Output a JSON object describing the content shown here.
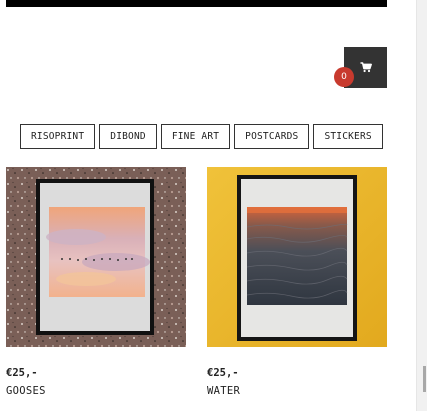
{
  "cart": {
    "count": "0",
    "icon": "cart-icon"
  },
  "filters": [
    {
      "label": "RISOPRINT"
    },
    {
      "label": "DIBOND"
    },
    {
      "label": "FINE ART"
    },
    {
      "label": "POSTCARDS"
    },
    {
      "label": "STICKERS"
    }
  ],
  "products": [
    {
      "price": "€25,-",
      "title": "GOOSES"
    },
    {
      "price": "€25,-",
      "title": "WATER"
    }
  ]
}
